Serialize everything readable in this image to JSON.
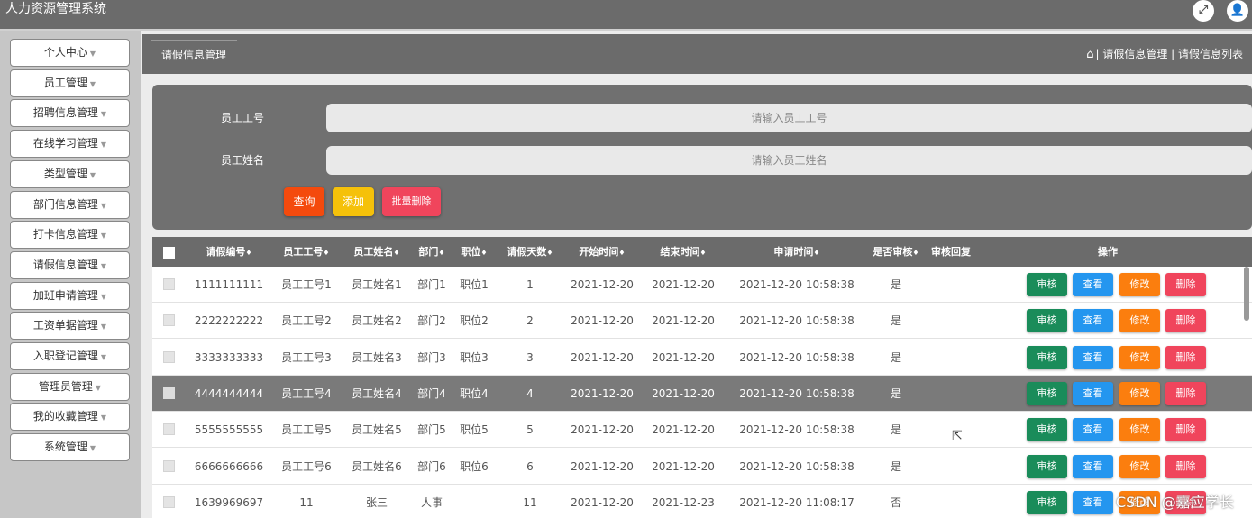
{
  "app": {
    "title": "人力资源管理系统"
  },
  "sidebar": {
    "items": [
      {
        "label": "个人中心"
      },
      {
        "label": "员工管理"
      },
      {
        "label": "招聘信息管理"
      },
      {
        "label": "在线学习管理"
      },
      {
        "label": "类型管理"
      },
      {
        "label": "部门信息管理"
      },
      {
        "label": "打卡信息管理"
      },
      {
        "label": "请假信息管理"
      },
      {
        "label": "加班申请管理"
      },
      {
        "label": "工资单据管理"
      },
      {
        "label": "入职登记管理"
      },
      {
        "label": "管理员管理"
      },
      {
        "label": "我的收藏管理"
      },
      {
        "label": "系统管理"
      }
    ]
  },
  "header": {
    "tab": "请假信息管理",
    "breadcrumb": "| 请假信息管理 | 请假信息列表"
  },
  "search": {
    "emp_no_label": "员工工号",
    "emp_no_placeholder": "请输入员工工号",
    "emp_name_label": "员工姓名",
    "emp_name_placeholder": "请输入员工姓名",
    "query_button": "查询",
    "add_button": "添加",
    "batch_delete_button": "批量删除"
  },
  "table": {
    "columns": [
      "请假编号",
      "员工工号",
      "员工姓名",
      "部门",
      "职位",
      "请假天数",
      "开始时间",
      "结束时间",
      "申请时间",
      "是否审核",
      "审核回复",
      "操作"
    ],
    "rows": [
      {
        "id": "1111111111",
        "emp_no": "员工工号1",
        "name": "员工姓名1",
        "dept": "部门1",
        "pos": "职位1",
        "days": "1",
        "start": "2021-12-20",
        "end": "2021-12-20",
        "applied": "2021-12-20 10:58:38",
        "audited": "是",
        "reply": ""
      },
      {
        "id": "2222222222",
        "emp_no": "员工工号2",
        "name": "员工姓名2",
        "dept": "部门2",
        "pos": "职位2",
        "days": "2",
        "start": "2021-12-20",
        "end": "2021-12-20",
        "applied": "2021-12-20 10:58:38",
        "audited": "是",
        "reply": ""
      },
      {
        "id": "3333333333",
        "emp_no": "员工工号3",
        "name": "员工姓名3",
        "dept": "部门3",
        "pos": "职位3",
        "days": "3",
        "start": "2021-12-20",
        "end": "2021-12-20",
        "applied": "2021-12-20 10:58:38",
        "audited": "是",
        "reply": ""
      },
      {
        "id": "4444444444",
        "emp_no": "员工工号4",
        "name": "员工姓名4",
        "dept": "部门4",
        "pos": "职位4",
        "days": "4",
        "start": "2021-12-20",
        "end": "2021-12-20",
        "applied": "2021-12-20 10:58:38",
        "audited": "是",
        "reply": ""
      },
      {
        "id": "5555555555",
        "emp_no": "员工工号5",
        "name": "员工姓名5",
        "dept": "部门5",
        "pos": "职位5",
        "days": "5",
        "start": "2021-12-20",
        "end": "2021-12-20",
        "applied": "2021-12-20 10:58:38",
        "audited": "是",
        "reply": ""
      },
      {
        "id": "6666666666",
        "emp_no": "员工工号6",
        "name": "员工姓名6",
        "dept": "部门6",
        "pos": "职位6",
        "days": "6",
        "start": "2021-12-20",
        "end": "2021-12-20",
        "applied": "2021-12-20 10:58:38",
        "audited": "是",
        "reply": ""
      },
      {
        "id": "1639969697",
        "emp_no": "11",
        "name": "张三",
        "dept": "人事",
        "pos": "",
        "days": "11",
        "start": "2021-12-20",
        "end": "2021-12-23",
        "applied": "2021-12-20 11:08:17",
        "audited": "否",
        "reply": ""
      }
    ],
    "highlighted_row": 3,
    "actions": {
      "audit": "审核",
      "view": "查看",
      "edit": "修改",
      "delete": "删除"
    }
  },
  "icons": {
    "expand": "fullscreen-icon",
    "user": "user-icon",
    "home": "home-icon",
    "cursor": "mouse-cursor-icon"
  },
  "watermark": "CSDN @嘉应学长",
  "colors": {
    "topbar": "#6b6b6b",
    "query": "#f44a0d",
    "add": "#f5c10a",
    "batch_delete": "#f0455c",
    "audit": "#1a8c5a",
    "view": "#2496ef",
    "edit": "#fb7e0e",
    "delete": "#f0455c"
  }
}
